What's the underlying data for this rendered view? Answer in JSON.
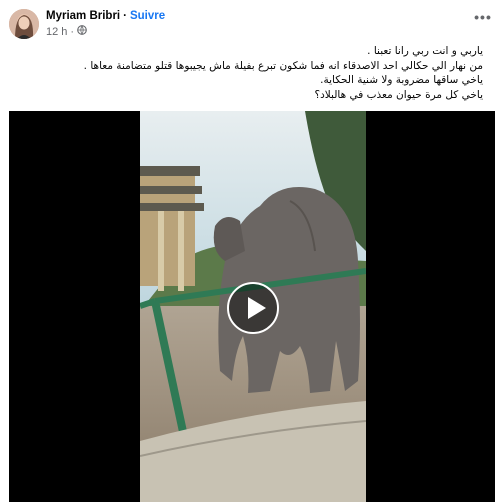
{
  "post": {
    "author": "Myriam Bribri",
    "separator": "·",
    "follow_label": "Suivre",
    "time": "12 h",
    "time_separator": "·",
    "audience_icon": "globe-icon",
    "more_icon": "more-horizontal-icon",
    "text_lines": [
      "ياربي و انت ربي رانا تعبنا .",
      "من نهار الي حكالي احد الاصدقاء انه فما شكون تبرع بفيلة ماش يجيبوها قتلو متضامنة معاها .",
      "ياخي ساقها مضروبة ولا شنية الحكاية.",
      "ياخي كل مرة حيوان معذب في هالبلاد؟"
    ]
  },
  "video": {
    "play_icon": "play-icon",
    "colors": {
      "sky": "#cfe3ea",
      "ground": "#9a8c7a",
      "railing": "#2f7a55",
      "elephant": "#6b6663"
    }
  }
}
